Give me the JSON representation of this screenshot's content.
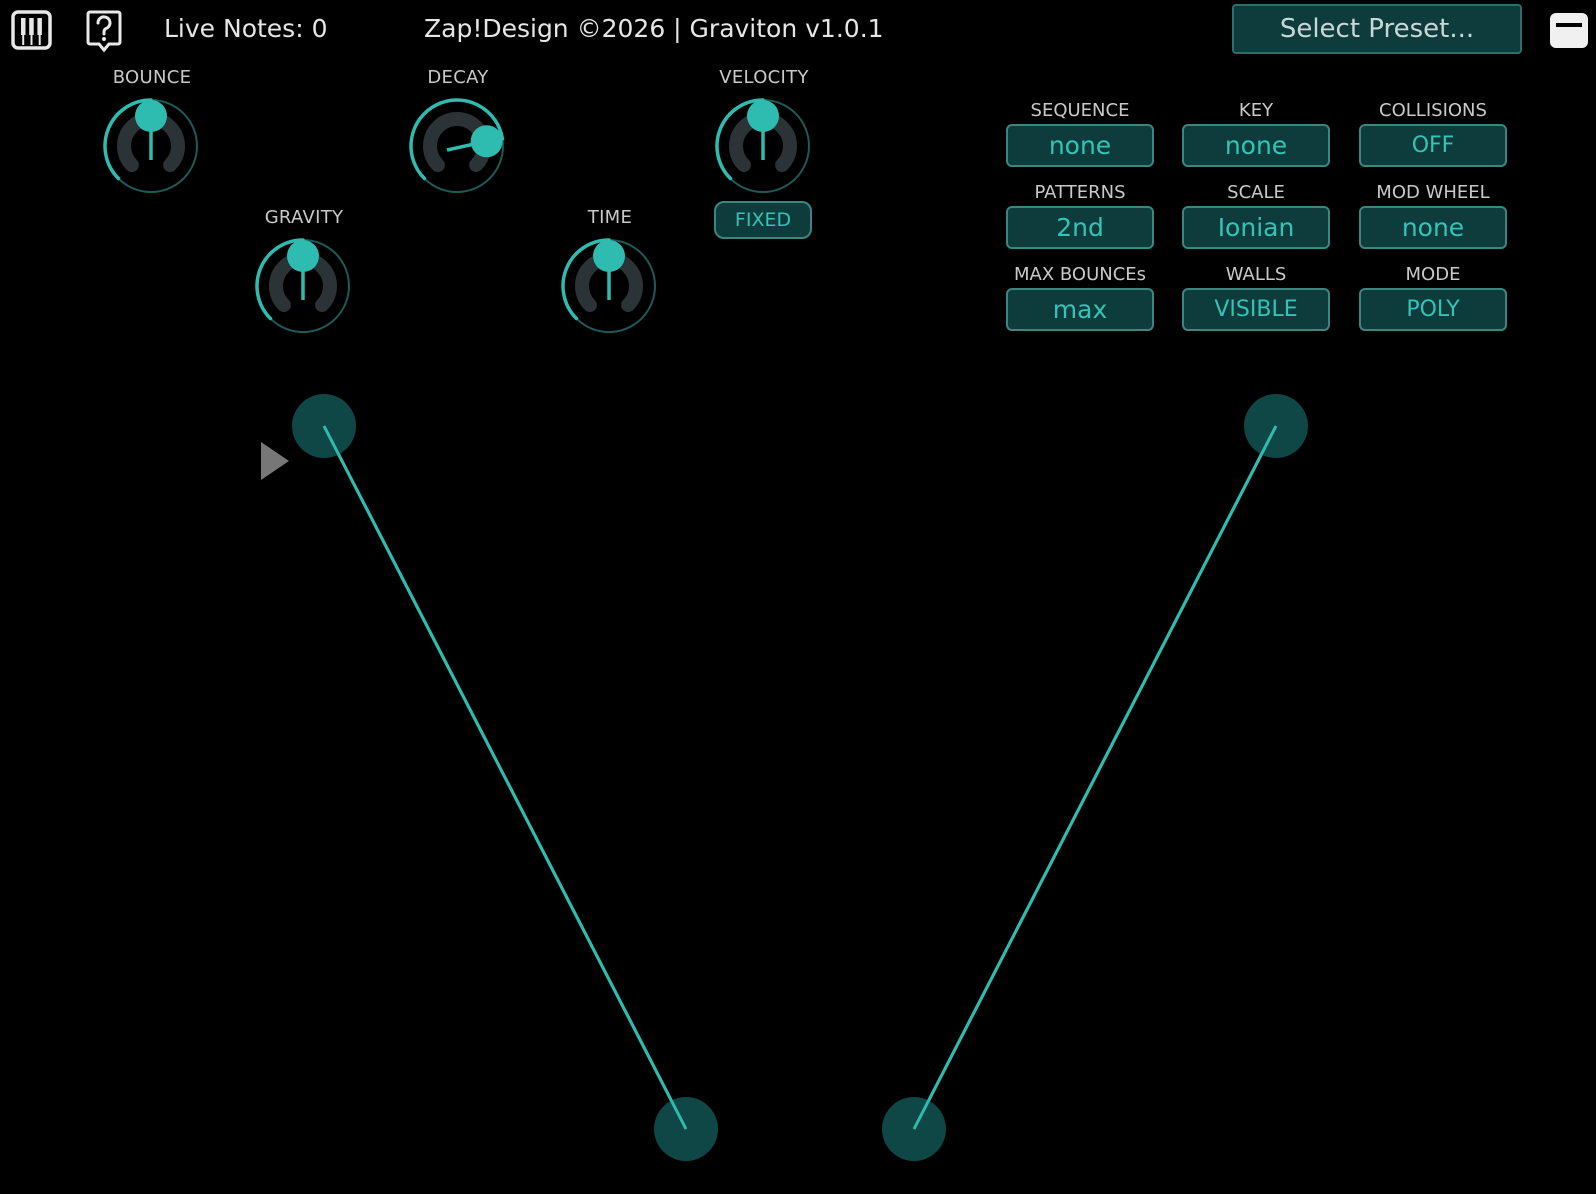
{
  "header": {
    "piano_icon": "piano-keys-icon",
    "help_icon": "help-bubble-icon",
    "live_notes": "Live Notes: 0",
    "title": "Zap!Design ©2026 | Graviton v1.0.1",
    "preset_label": "Select Preset...",
    "window_icon": "window-icon"
  },
  "knobs": [
    {
      "id": "bounce",
      "label": "BOUNCE",
      "value": 0.5
    },
    {
      "id": "decay",
      "label": "DECAY",
      "value": 0.8
    },
    {
      "id": "velocity",
      "label": "VELOCITY",
      "value": 0.5
    },
    {
      "id": "gravity",
      "label": "GRAVITY",
      "value": 0.5
    },
    {
      "id": "time",
      "label": "TIME",
      "value": 0.5
    }
  ],
  "velocity_mode": "FIXED",
  "settings": [
    {
      "label": "SEQUENCE",
      "value": "none"
    },
    {
      "label": "KEY",
      "value": "none"
    },
    {
      "label": "COLLISIONS",
      "value": "OFF"
    },
    {
      "label": "PATTERNS",
      "value": "2nd"
    },
    {
      "label": "SCALE",
      "value": "Ionian"
    },
    {
      "label": "MOD WHEEL",
      "value": "none"
    },
    {
      "label": "MAX BOUNCEs",
      "value": "max"
    },
    {
      "label": "WALLS",
      "value": "VISIBLE"
    },
    {
      "label": "MODE",
      "value": "POLY"
    }
  ],
  "colors": {
    "accent": "#2fbcb0",
    "button_bg": "#0e3b3b",
    "button_border": "#3c8682",
    "handle": "#0f4646",
    "play": "#7a7a7a"
  }
}
